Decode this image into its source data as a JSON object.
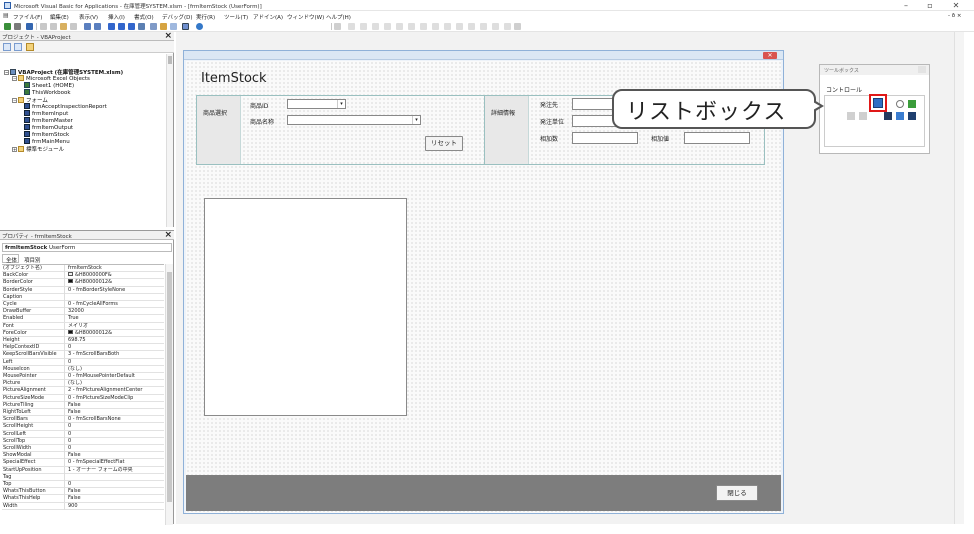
{
  "window": {
    "title": "Microsoft Visual Basic for Applications - 在庫管理SYSTEM.xlsm - [frmItemStock (UserForm)]"
  },
  "menu": [
    "ファイル(F)",
    "編集(E)",
    "表示(V)",
    "挿入(I)",
    "書式(O)",
    "デバッグ(D)",
    "実行(R)",
    "ツール(T)",
    "アドイン(A)",
    "ウィンドウ(W)",
    "ヘルプ(H)"
  ],
  "project": {
    "pane_title": "プロジェクト - VBAProject",
    "root": "VBAProject (在庫管理SYSTEM.xlsm)",
    "excel_objects": "Microsoft Excel Objects",
    "sheet1": "Sheet1 (HOME)",
    "thisworkbook": "ThisWorkbook",
    "forms_folder": "フォーム",
    "forms": [
      "frmAcceptInspectionReport",
      "frmItemInput",
      "frmItemMaster",
      "frmItemOutput",
      "frmItemStock",
      "frmMainMenu"
    ],
    "modules_folder": "標準モジュール"
  },
  "properties": {
    "pane_title": "プロパティ - frmItemStock",
    "object_name": "frmItemStock",
    "object_type": "UserForm",
    "tab_all": "全体",
    "tab_category": "項目別",
    "rows": [
      [
        "(オブジェクト名)",
        "frmItemStock"
      ],
      [
        "BackColor",
        "&H8000000F&"
      ],
      [
        "BorderColor",
        "&H80000012&"
      ],
      [
        "BorderStyle",
        "0 - fmBorderStyleNone"
      ],
      [
        "Caption",
        ""
      ],
      [
        "Cycle",
        "0 - fmCycleAllForms"
      ],
      [
        "DrawBuffer",
        "32000"
      ],
      [
        "Enabled",
        "True"
      ],
      [
        "Font",
        "メイリオ"
      ],
      [
        "ForeColor",
        "&H80000012&"
      ],
      [
        "Height",
        "698.75"
      ],
      [
        "HelpContextID",
        "0"
      ],
      [
        "KeepScrollBarsVisible",
        "3 - fmScrollBarsBoth"
      ],
      [
        "Left",
        "0"
      ],
      [
        "MouseIcon",
        "(なし)"
      ],
      [
        "MousePointer",
        "0 - fmMousePointerDefault"
      ],
      [
        "Picture",
        "(なし)"
      ],
      [
        "PictureAlignment",
        "2 - fmPictureAlignmentCenter"
      ],
      [
        "PictureSizeMode",
        "0 - fmPictureSizeModeClip"
      ],
      [
        "PictureTiling",
        "False"
      ],
      [
        "RightToLeft",
        "False"
      ],
      [
        "ScrollBars",
        "0 - fmScrollBarsNone"
      ],
      [
        "ScrollHeight",
        "0"
      ],
      [
        "ScrollLeft",
        "0"
      ],
      [
        "ScrollTop",
        "0"
      ],
      [
        "ScrollWidth",
        "0"
      ],
      [
        "ShowModal",
        "False"
      ],
      [
        "SpecialEffect",
        "0 - fmSpecialEffectFlat"
      ],
      [
        "StartUpPosition",
        "1 - オーナー フォームの中央"
      ],
      [
        "Tag",
        ""
      ],
      [
        "Top",
        "0"
      ],
      [
        "WhatsThisButton",
        "False"
      ],
      [
        "WhatsThisHelp",
        "False"
      ],
      [
        "Width",
        "900"
      ]
    ],
    "swatch_colors": {
      "BackColor": "#f0f0f0",
      "BorderColor": "#111111",
      "ForeColor": "#111111"
    }
  },
  "form": {
    "title": "ItemStock",
    "frame1_label": "商品選択",
    "item_id_label": "商品ID",
    "item_name_label": "商品名称",
    "reset_button": "リセット",
    "frame2_label": "詳細情報",
    "supplier_label": "発注先",
    "order_unit_label": "発注単位",
    "stock_count_label": "相加数",
    "extra_label": "相加値",
    "close_button": "閉じる"
  },
  "toolbox": {
    "title": "ツールボックス",
    "tab": "コントロール"
  },
  "callout": {
    "text": "リストボックス"
  },
  "colors": {
    "callout_border": "#555555",
    "highlight": "#e01818",
    "form_footer": "#7d7d7d"
  }
}
